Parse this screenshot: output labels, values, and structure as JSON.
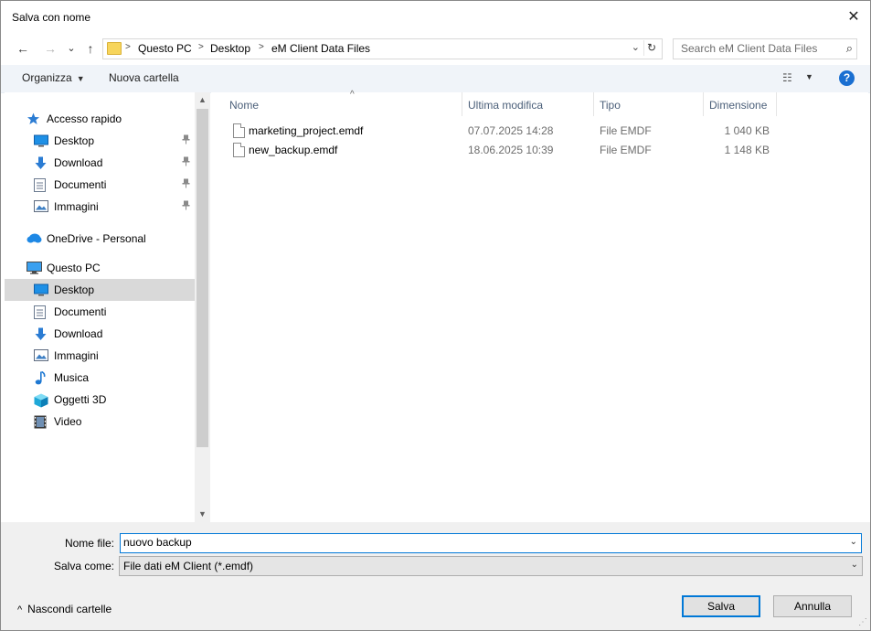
{
  "window": {
    "title": "Salva con nome",
    "close_label": "✕"
  },
  "nav": {
    "back": "←",
    "forward": "→",
    "recent": "⌄",
    "up": "↑",
    "breadcrumb": [
      "Questo PC",
      "Desktop",
      "eM Client Data Files"
    ],
    "separator": ">",
    "dropdown": "⌄",
    "refresh": "↻",
    "search_placeholder": "Search eM Client Data Files",
    "search_icon": "⌕"
  },
  "toolbar": {
    "organize_label": "Organizza",
    "new_folder_label": "Nuova cartella",
    "caret": "▼",
    "view_icon": "☷",
    "help_icon": "?"
  },
  "sidebar": {
    "pin_glyph": "📌",
    "items": [
      {
        "label": "Accesso rapido",
        "icon": "star-icon",
        "level": 0
      },
      {
        "label": "Desktop",
        "icon": "desktop-icon",
        "level": 1,
        "pinned": true
      },
      {
        "label": "Download",
        "icon": "download-icon",
        "level": 1,
        "pinned": true
      },
      {
        "label": "Documenti",
        "icon": "documents-icon",
        "level": 1,
        "pinned": true
      },
      {
        "label": "Immagini",
        "icon": "pictures-icon",
        "level": 1,
        "pinned": true
      },
      {
        "label": "OneDrive - Personal",
        "icon": "cloud-icon",
        "level": 0
      },
      {
        "label": "Questo PC",
        "icon": "computer-icon",
        "level": 0
      },
      {
        "label": "Desktop",
        "icon": "desktop-icon",
        "level": 1,
        "selected": true
      },
      {
        "label": "Documenti",
        "icon": "documents-icon",
        "level": 1
      },
      {
        "label": "Download",
        "icon": "download-icon",
        "level": 1
      },
      {
        "label": "Immagini",
        "icon": "pictures-icon",
        "level": 1
      },
      {
        "label": "Musica",
        "icon": "music-icon",
        "level": 1
      },
      {
        "label": "Oggetti 3D",
        "icon": "cube-icon",
        "level": 1
      },
      {
        "label": "Video",
        "icon": "video-icon",
        "level": 1
      }
    ],
    "scroll_up": "▲",
    "scroll_down": "▼"
  },
  "files": {
    "columns": [
      "Nome",
      "Ultima modifica",
      "Tipo",
      "Dimensione"
    ],
    "sort_arrow": "^",
    "rows": [
      {
        "name": "marketing_project.emdf",
        "modified": "07.07.2025 14:28",
        "type": "File EMDF",
        "size": "1 040 KB"
      },
      {
        "name": "new_backup.emdf",
        "modified": "18.06.2025 10:39",
        "type": "File EMDF",
        "size": "1 148 KB"
      }
    ]
  },
  "footer": {
    "filename_label": "Nome file:",
    "filename_value": "nuovo backup",
    "savetype_label": "Salva come:",
    "savetype_value": "File dati eM Client (*.emdf)",
    "dropdown": "⌄",
    "hide_folders_label": "Nascondi cartelle",
    "hide_caret": "^",
    "save_label": "Salva",
    "cancel_label": "Annulla"
  }
}
